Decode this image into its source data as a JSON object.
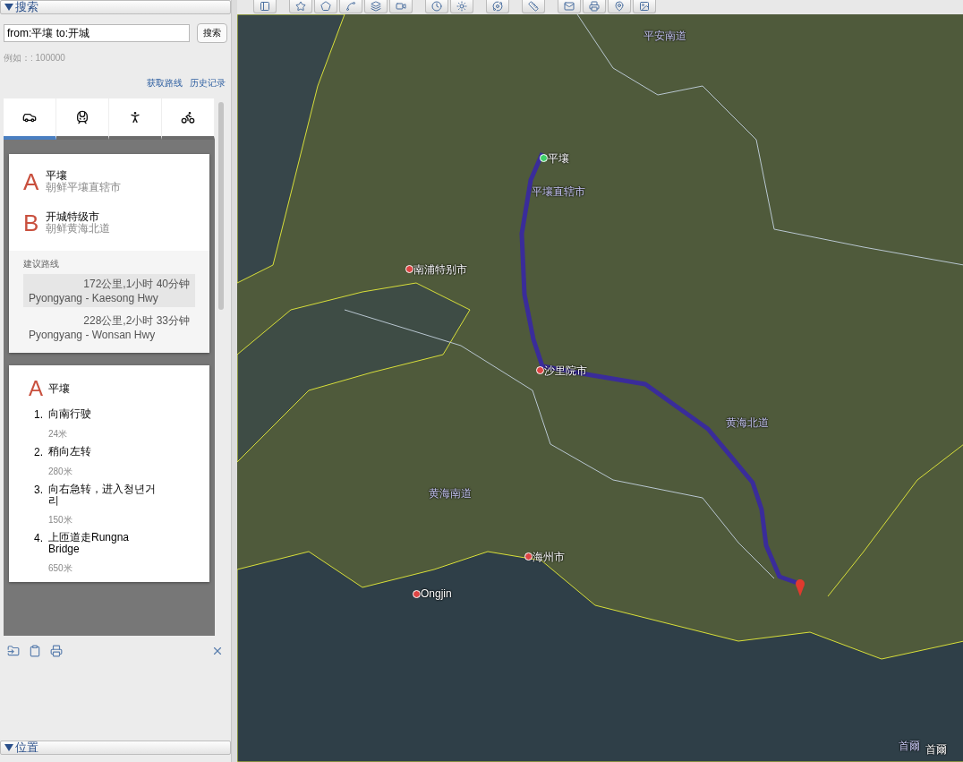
{
  "search": {
    "title": "搜索",
    "expanded": true,
    "query": "from:平壤 to:开城",
    "button": "搜索",
    "hint": "例如：: 100000",
    "links": [
      "获取路线",
      "历史记录"
    ]
  },
  "modes": [
    {
      "kind": "car",
      "selected": true
    },
    {
      "kind": "train",
      "selected": false
    },
    {
      "kind": "walk",
      "selected": false
    },
    {
      "kind": "bike",
      "selected": false
    }
  ],
  "endpoints": [
    {
      "letter": "A",
      "name": "平壤",
      "region": "朝鲜平壤直辖市"
    },
    {
      "letter": "B",
      "name": "开城特级市",
      "region": "朝鲜黄海北道"
    }
  ],
  "routes": {
    "title": "建议路线",
    "items": [
      {
        "summary": "172公里,1小时 40分钟",
        "road": "Pyongyang - Kaesong Hwy",
        "selected": true
      },
      {
        "summary": "228公里,2小时 33分钟",
        "road": "Pyongyang - Wonsan Hwy",
        "selected": false
      }
    ]
  },
  "steps": {
    "start": {
      "letter": "A",
      "name": "平壤"
    },
    "items": [
      {
        "number": "1.",
        "text": "向南行驶",
        "distance": "24米"
      },
      {
        "number": "2.",
        "text": "稍向左转",
        "distance": "280米"
      },
      {
        "number": "3.",
        "text": "向右急转，进入청년거리",
        "distance": "150米"
      },
      {
        "number": "4.",
        "text": "上匝道走Rungna Bridge",
        "distance": "650米"
      }
    ]
  },
  "places": {
    "title": "位置",
    "expanded": true
  },
  "map_labels": [
    {
      "text": "平安南道",
      "kind": "province"
    },
    {
      "text": "平壤",
      "kind": "start"
    },
    {
      "text": "平壤直辖市",
      "kind": "province"
    },
    {
      "text": "南浦特别市",
      "kind": "city"
    },
    {
      "text": "沙里院市",
      "kind": "city"
    },
    {
      "text": "黄海北道",
      "kind": "province"
    },
    {
      "text": "黄海南道",
      "kind": "province"
    },
    {
      "text": "海州市",
      "kind": "city"
    },
    {
      "text": "Ongjin",
      "kind": "city"
    },
    {
      "text": "首爾",
      "kind": "province"
    },
    {
      "text": "首爾",
      "kind": "plain"
    }
  ]
}
